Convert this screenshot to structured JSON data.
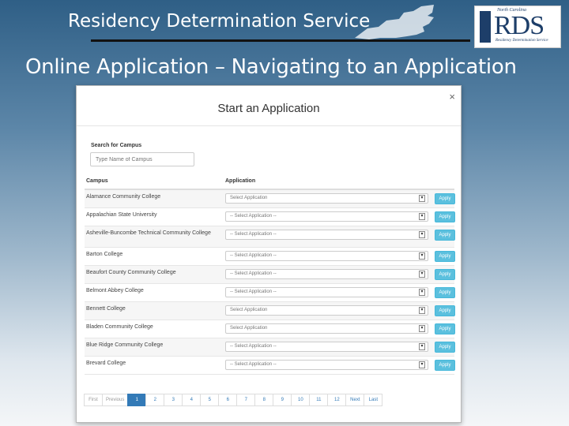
{
  "slide": {
    "title": "Residency Determination Service",
    "subtitle": "Online Application – Navigating to an Application"
  },
  "logo": {
    "small_text": "North Carolina",
    "main_text": "RDS",
    "sub_text": "Residency Determination Service"
  },
  "modal": {
    "title": "Start an Application",
    "close_label": "×",
    "search_label": "Search for Campus",
    "search_placeholder": "Type Name of Campus",
    "col_campus": "Campus",
    "col_application": "Application",
    "apply_label": "Apply",
    "rows": [
      {
        "campus": "Alamance Community College",
        "select": "Select Application"
      },
      {
        "campus": "Appalachian State University",
        "select": "-- Select Application --"
      },
      {
        "campus": "Asheville-Buncombe Technical Community College",
        "select": "-- Select Application --"
      },
      {
        "campus": "Barton College",
        "select": "-- Select Application --"
      },
      {
        "campus": "Beaufort County Community College",
        "select": "-- Select Application --"
      },
      {
        "campus": "Belmont Abbey College",
        "select": "-- Select Application --"
      },
      {
        "campus": "Bennett College",
        "select": "Select Application"
      },
      {
        "campus": "Bladen Community College",
        "select": "Select Application"
      },
      {
        "campus": "Blue Ridge Community College",
        "select": "-- Select Application --"
      },
      {
        "campus": "Brevard College",
        "select": "-- Select Application --"
      }
    ],
    "pagination": [
      "First",
      "Previous",
      "1",
      "2",
      "3",
      "4",
      "5",
      "6",
      "7",
      "8",
      "9",
      "10",
      "11",
      "12",
      "Next",
      "Last"
    ],
    "active_page": "1"
  },
  "colors": {
    "apply_button": "#5bc0de",
    "active_page": "#337ab7",
    "logo_blue": "#1d3e69"
  }
}
